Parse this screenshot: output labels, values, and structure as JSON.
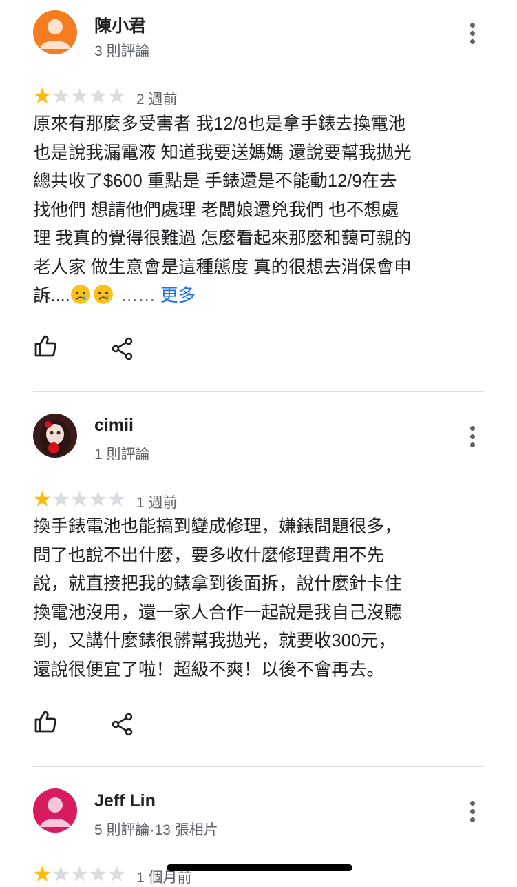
{
  "colors": {
    "star_filled": "#fbbc04",
    "star_empty": "#dadce0",
    "link": "#1a73e8",
    "secondary_text": "#5f6368"
  },
  "reviews": [
    {
      "author": "陳小君",
      "meta": "3 則評論",
      "rating": 1,
      "time": "2 週前",
      "avatar": "default-orange",
      "lines": [
        "原來有那麼多受害者 我12/8也是拿手錶去換電池",
        "也是說我漏電液 知道我要送媽媽 還說要幫我拋光",
        "總共收了$600 重點是 手錶還是不能動12/9在去",
        "找他們 想請他們處理 老闆娘還兇我們 也不想處",
        "理 我真的覺得很難過 怎麼看起來那麼和藹可親的",
        "老人家 做生意會是這種態度 真的很想去消保會申"
      ],
      "last_line": "訴....",
      "emojis": [
        "crying-face",
        "crying-face"
      ],
      "ellipsis": "……",
      "more_label": "更多"
    },
    {
      "author": "cimii",
      "meta": "1 則評論",
      "rating": 1,
      "time": "1 週前",
      "avatar": "photo",
      "lines": [
        "換手錶電池也能搞到變成修理，嫌錶問題很多，",
        "問了也說不出什麼，要多收什麼修理費用不先",
        "說，就直接把我的錶拿到後面拆，說什麼針卡住",
        "換電池沒用，還一家人合作一起說是我自己沒聽",
        "到，又講什麼錶很髒幫我拋光，就要收300元，",
        "還說很便宜了啦！超級不爽！以後不會再去。"
      ]
    },
    {
      "author": "Jeff Lin",
      "meta": "5 則評論·13 張相片",
      "rating": 1,
      "time": "1 個月前",
      "avatar": "default-pink"
    }
  ]
}
